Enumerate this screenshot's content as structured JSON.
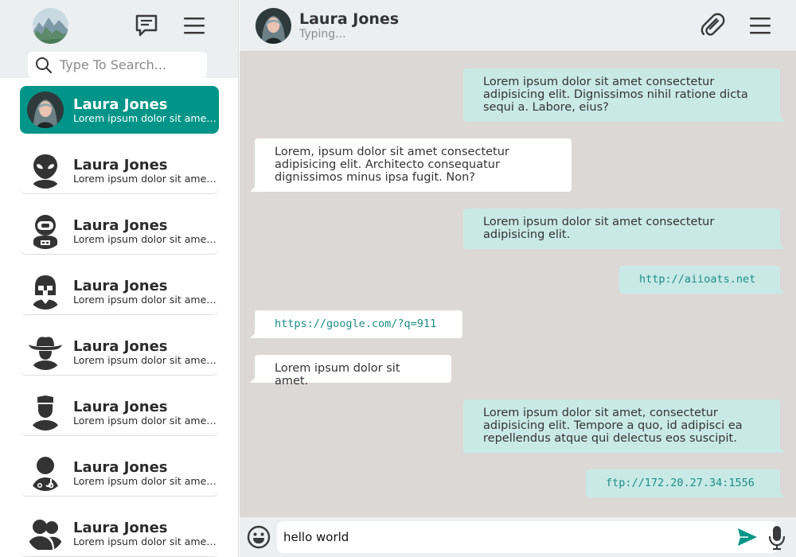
{
  "sidebar": {
    "search": {
      "placeholder": "Type To Search...",
      "value": ""
    },
    "header_icons": [
      "avatar-landscape",
      "new-chat-icon",
      "menu-icon"
    ],
    "contacts": [
      {
        "name": "Laura Jones",
        "preview": "Lorem ipsum dolor sit amet consectetur",
        "avatar": "photo",
        "active": true
      },
      {
        "name": "Laura Jones",
        "preview": "Lorem ipsum dolor sit amet consectetur",
        "avatar": "alien-icon",
        "active": false
      },
      {
        "name": "Laura Jones",
        "preview": "Lorem ipsum dolor sit amet consectetur",
        "avatar": "astronaut-icon",
        "active": false
      },
      {
        "name": "Laura Jones",
        "preview": "Lorem ipsum dolor sit amet consectetur",
        "avatar": "helmet-icon",
        "active": false
      },
      {
        "name": "Laura Jones",
        "preview": "Lorem ipsum dolor sit amet consectetur",
        "avatar": "cowboy-icon",
        "active": false
      },
      {
        "name": "Laura Jones",
        "preview": "Lorem ipsum dolor sit amet consectetur",
        "avatar": "police-icon",
        "active": false
      },
      {
        "name": "Laura Jones",
        "preview": "Lorem ipsum dolor sit amet consectetur",
        "avatar": "doctor-icon",
        "active": false
      },
      {
        "name": "Laura Jones",
        "preview": "Lorem ipsum dolor sit amet consectetur",
        "avatar": "group-icon",
        "active": false
      }
    ]
  },
  "chat": {
    "header": {
      "name": "Laura Jones",
      "status": "Typing..."
    },
    "messages": [
      {
        "direction": "out",
        "kind": "text",
        "text": "Lorem ipsum dolor sit amet consectetur adipisicing elit. Dignissimos nihil ratione dicta sequi a. Labore, eius?"
      },
      {
        "direction": "in",
        "kind": "text",
        "text": "Lorem, ipsum dolor sit amet consectetur adipisicing elit. Architecto consequatur dignissimos minus ipsa fugit. Non?"
      },
      {
        "direction": "out",
        "kind": "text",
        "text": "Lorem ipsum dolor sit amet consectetur adipisicing elit."
      },
      {
        "direction": "out",
        "kind": "link",
        "text": "http://aiioats.net"
      },
      {
        "direction": "in",
        "kind": "link",
        "text": "https://google.com/?q=911"
      },
      {
        "direction": "in",
        "kind": "text",
        "text": "Lorem ipsum dolor sit amet."
      },
      {
        "direction": "out",
        "kind": "text",
        "text": "Lorem ipsum dolor sit amet, consectetur adipisicing elit. Tempore a quo, id adipisci ea repellendus atque qui delectus eos suscipit."
      },
      {
        "direction": "out",
        "kind": "link",
        "text": "ftp://172.20.27.34:1556"
      }
    ],
    "composer": {
      "value": "hello world"
    }
  },
  "colors": {
    "accent": "#009588",
    "outgoing_bubble": "#c9e9e6",
    "incoming_bubble": "#ffffff",
    "chat_background": "#dcd8d6",
    "header_background": "#ebeff0",
    "link_text": "#1a8d86",
    "icon": "#3a3a3a"
  }
}
